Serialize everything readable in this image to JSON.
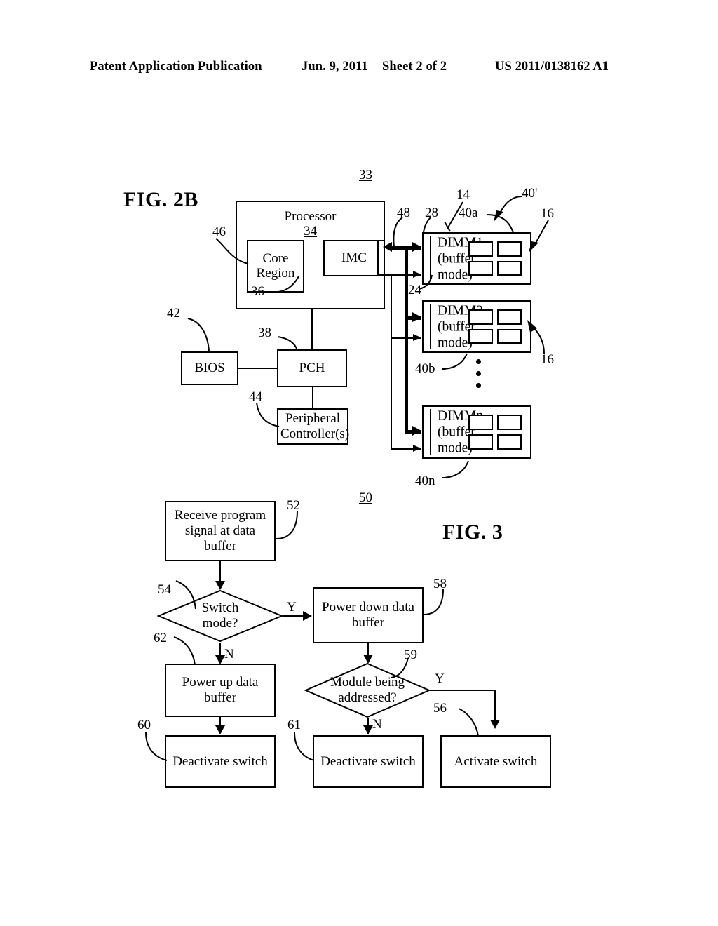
{
  "header": {
    "publication": "Patent Application Publication",
    "date": "Jun. 9, 2011",
    "sheet": "Sheet 2 of 2",
    "patent_number": "US 2011/0138162 A1"
  },
  "fig2b": {
    "title": "FIG. 2B",
    "system_ref": "33",
    "processor": {
      "label": "Processor",
      "ref": "34",
      "core_region": {
        "label": "Core\nRegion",
        "ref": "46"
      },
      "imc": {
        "label": "IMC",
        "ref": "36"
      }
    },
    "bios": {
      "label": "BIOS",
      "ref": "42"
    },
    "pch": {
      "label": "PCH",
      "ref": "38"
    },
    "peripheral": {
      "label": "Peripheral\nController(s)",
      "ref": "44"
    },
    "buses": {
      "data_bus_ref": "28",
      "command_bus_ref": "48",
      "connector_ref": "24",
      "channel_ref": "14"
    },
    "memory_group_ref": "40'",
    "module_refs": [
      "16",
      "16"
    ],
    "dimms": [
      {
        "label": "DIMM1\n(buffer\nmode)",
        "ref": "40a"
      },
      {
        "label": "DIMM2\n(buffer\nmode)",
        "ref": "40b"
      },
      {
        "label": "DIMMn\n(buffer\nmode)",
        "ref": "40n"
      }
    ]
  },
  "fig3": {
    "title": "FIG. 3",
    "flow_ref": "50",
    "nodes": [
      {
        "id": "n52",
        "type": "process",
        "label": "Receive program\nsignal at data buffer",
        "ref": "52"
      },
      {
        "id": "n54",
        "type": "decision",
        "label": "Switch\nmode?",
        "ref": "54"
      },
      {
        "id": "n58",
        "type": "process",
        "label": "Power down data\nbuffer",
        "ref": "58"
      },
      {
        "id": "n62",
        "type": "process",
        "label": "Power up data buffer",
        "ref": "62"
      },
      {
        "id": "n59",
        "type": "decision",
        "label": "Module being\naddressed?",
        "ref": "59"
      },
      {
        "id": "n60",
        "type": "process",
        "label": "Deactivate switch",
        "ref": "60"
      },
      {
        "id": "n61",
        "type": "process",
        "label": "Deactivate switch",
        "ref": "61"
      },
      {
        "id": "n56",
        "type": "process",
        "label": "Activate switch",
        "ref": "56"
      }
    ],
    "branch_labels": {
      "switch_yes": "Y",
      "switch_no": "N",
      "module_yes": "Y",
      "module_no": "N"
    }
  },
  "colors": {
    "ink": "#000000",
    "paper": "#ffffff"
  }
}
